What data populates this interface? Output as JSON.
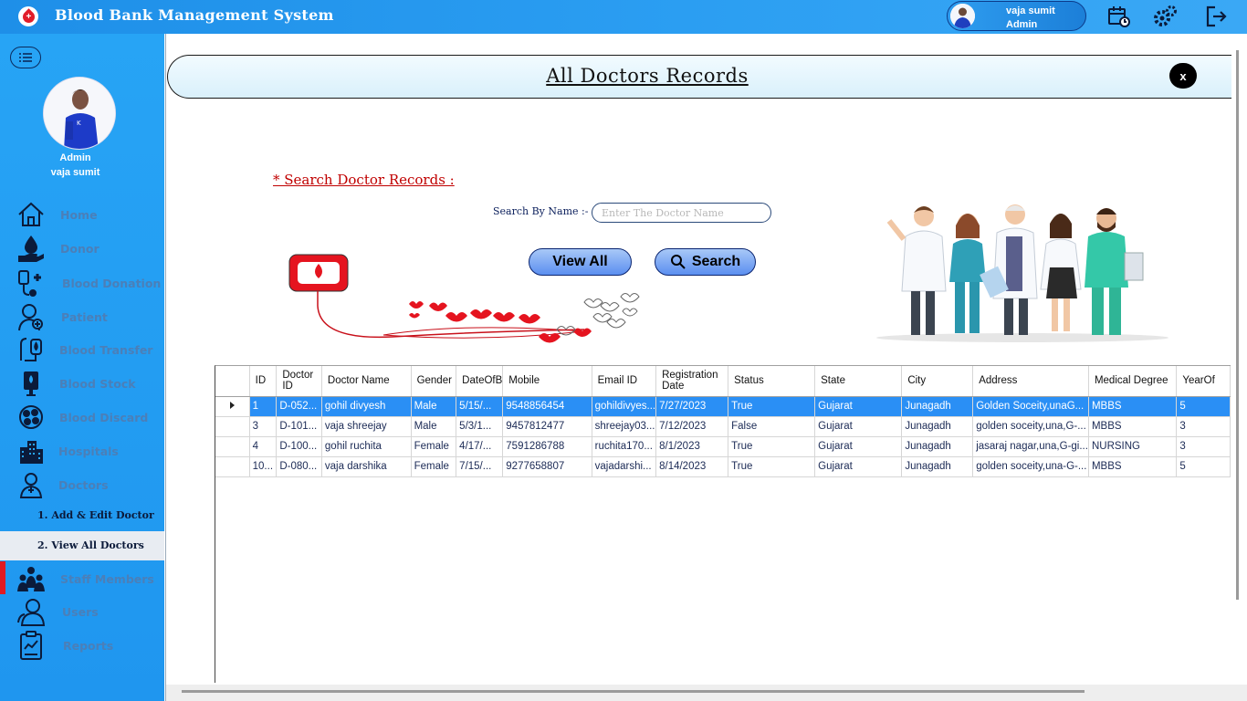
{
  "app": {
    "title": "Blood Bank Management System"
  },
  "user": {
    "name": "vaja sumit",
    "role": "Admin"
  },
  "sidebar": {
    "role": "Admin",
    "name": "vaja sumit",
    "items": [
      {
        "label": "Home",
        "icon": "home-icon"
      },
      {
        "label": "Donor",
        "icon": "donor-icon"
      },
      {
        "label": "Blood Donation",
        "icon": "blood-donation-icon"
      },
      {
        "label": "Patient",
        "icon": "patient-icon"
      },
      {
        "label": "Blood Transfer",
        "icon": "blood-transfer-icon"
      },
      {
        "label": "Blood Stock",
        "icon": "blood-stock-icon"
      },
      {
        "label": "Blood Discard",
        "icon": "blood-discard-icon"
      },
      {
        "label": "Hospitals",
        "icon": "hospital-icon"
      },
      {
        "label": "Doctors",
        "icon": "doctor-icon"
      },
      {
        "label": "Staff Members",
        "icon": "staff-icon"
      },
      {
        "label": "Users",
        "icon": "users-icon"
      },
      {
        "label": "Reports",
        "icon": "reports-icon"
      }
    ],
    "sub_items": [
      {
        "label": "1.  Add & Edit Doctor"
      },
      {
        "label": "2.  View All Doctors"
      }
    ]
  },
  "page": {
    "title": "All Doctors Records",
    "close_label": "x",
    "search_heading": "* Search Doctor Records  :",
    "search_label": "Search By Name  :-",
    "search_placeholder": "Enter The Doctor Name",
    "view_all_label": "View All",
    "search_label_btn": "Search"
  },
  "grid": {
    "columns": [
      "ID",
      "Doctor ID",
      "Doctor Name",
      "Gender",
      "DateOfB",
      "Mobile",
      "Email ID",
      "Registration Date",
      "Status",
      "State",
      "City",
      "Address",
      "Medical Degree",
      "YearOf"
    ],
    "rows": [
      [
        "1",
        "D-052...",
        "gohil divyesh",
        "Male",
        "5/15/...",
        "9548856454",
        "gohildivyes...",
        "7/27/2023",
        "True",
        "Gujarat",
        "Junagadh",
        "Golden Soceity,unaG...",
        "MBBS",
        "5"
      ],
      [
        "3",
        "D-101...",
        "vaja shreejay",
        "Male",
        "5/3/1...",
        "9457812477",
        "shreejay03...",
        "7/12/2023",
        "False",
        "Gujarat",
        "Junagadh",
        "golden soceity,una,G-...",
        "MBBS",
        "3"
      ],
      [
        "4",
        "D-100...",
        "gohil ruchita",
        "Female",
        "4/17/...",
        "7591286788",
        "ruchita170...",
        "8/1/2023",
        "True",
        "Gujarat",
        "Junagadh",
        "jasaraj nagar,una,G-gi...",
        "NURSING",
        "3"
      ],
      [
        "10...",
        "D-080...",
        "vaja darshika",
        "Female",
        "7/15/...",
        "9277658807",
        "vajadarshi...",
        "8/14/2023",
        "True",
        "Gujarat",
        "Junagadh",
        "golden soceity,una-G-...",
        "MBBS",
        "5"
      ]
    ],
    "selected_row": 0
  },
  "colors": {
    "topbar": "#1e8fe8",
    "sidebar": "#27a4f5",
    "selected_row": "#2a8ff5",
    "heading_red": "#c00000",
    "active_marker": "#e01a22"
  }
}
